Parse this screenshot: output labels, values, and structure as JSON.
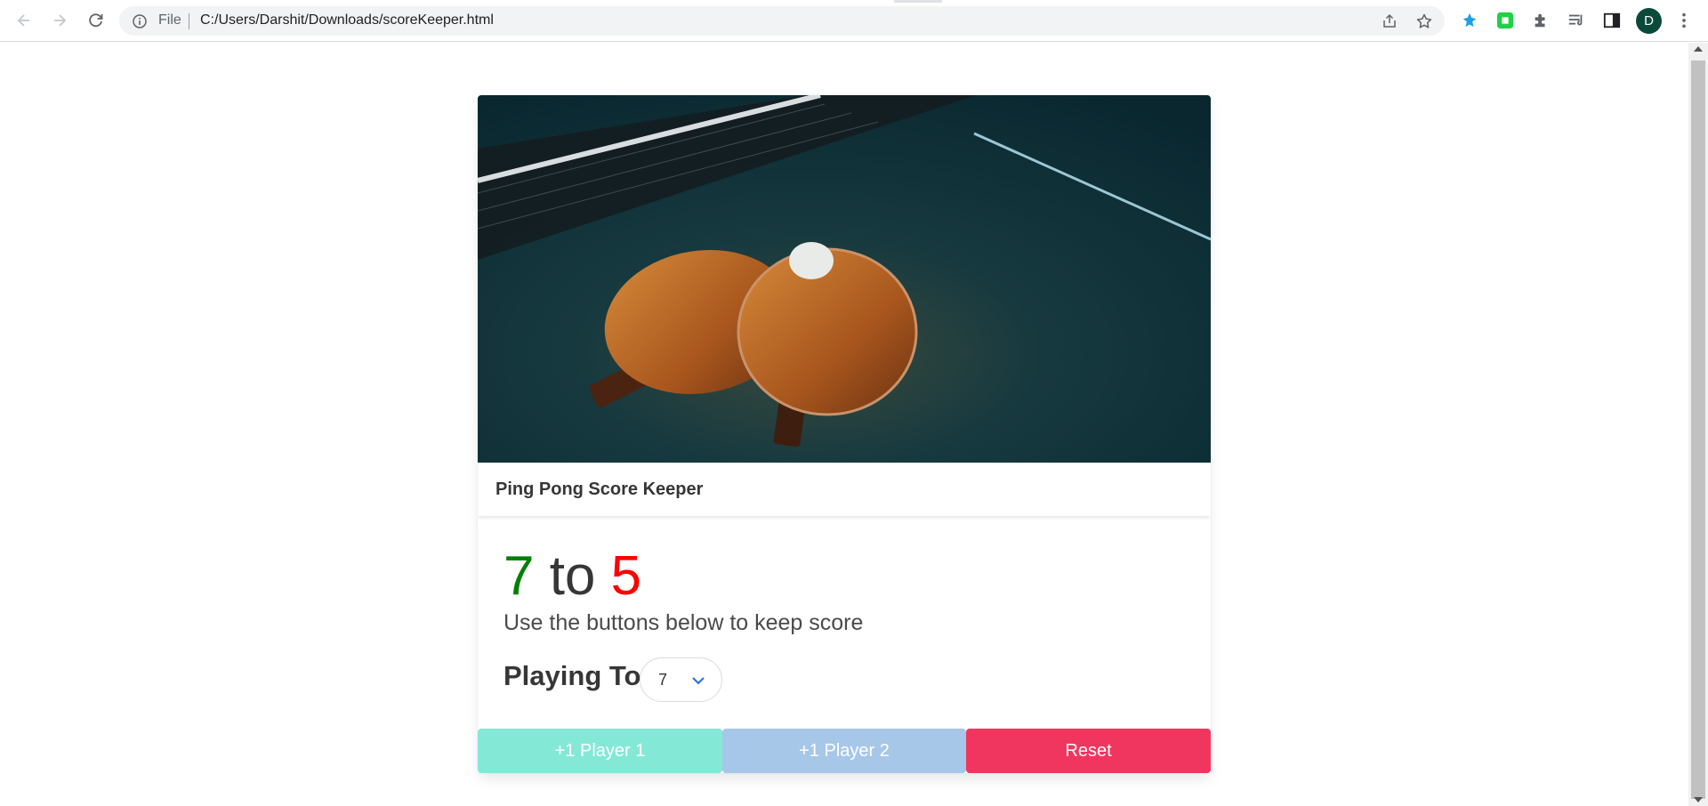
{
  "browser": {
    "address_scheme_label": "File",
    "url": "C:/Users/Darshit/Downloads/scoreKeeper.html",
    "profile_initial": "D",
    "icons": [
      "back-icon",
      "forward-icon",
      "reload-icon",
      "info-icon",
      "share-icon",
      "star-icon",
      "extension-blue-icon",
      "extension-green-icon",
      "puzzle-icon",
      "reading-list-icon",
      "side-panel-icon",
      "menu-dots-icon"
    ]
  },
  "card": {
    "image_alt": "table tennis paddles and ball on table",
    "title": "Ping Pong Score Keeper",
    "score": {
      "player1": "7",
      "separator": " to ",
      "player2": "5"
    },
    "subtitle": "Use the buttons below to keep score",
    "playing_to_label": "Playing To",
    "playing_to_value": "7",
    "buttons": {
      "player1": "+1 Player 1",
      "player2": "+1 Player 2",
      "reset": "Reset"
    }
  },
  "colors": {
    "player1_score": "#008000",
    "player2_score": "#ff0000",
    "btn_player1": "#84e8d7",
    "btn_player2": "#a6c7e8",
    "btn_reset": "#f0365f"
  }
}
